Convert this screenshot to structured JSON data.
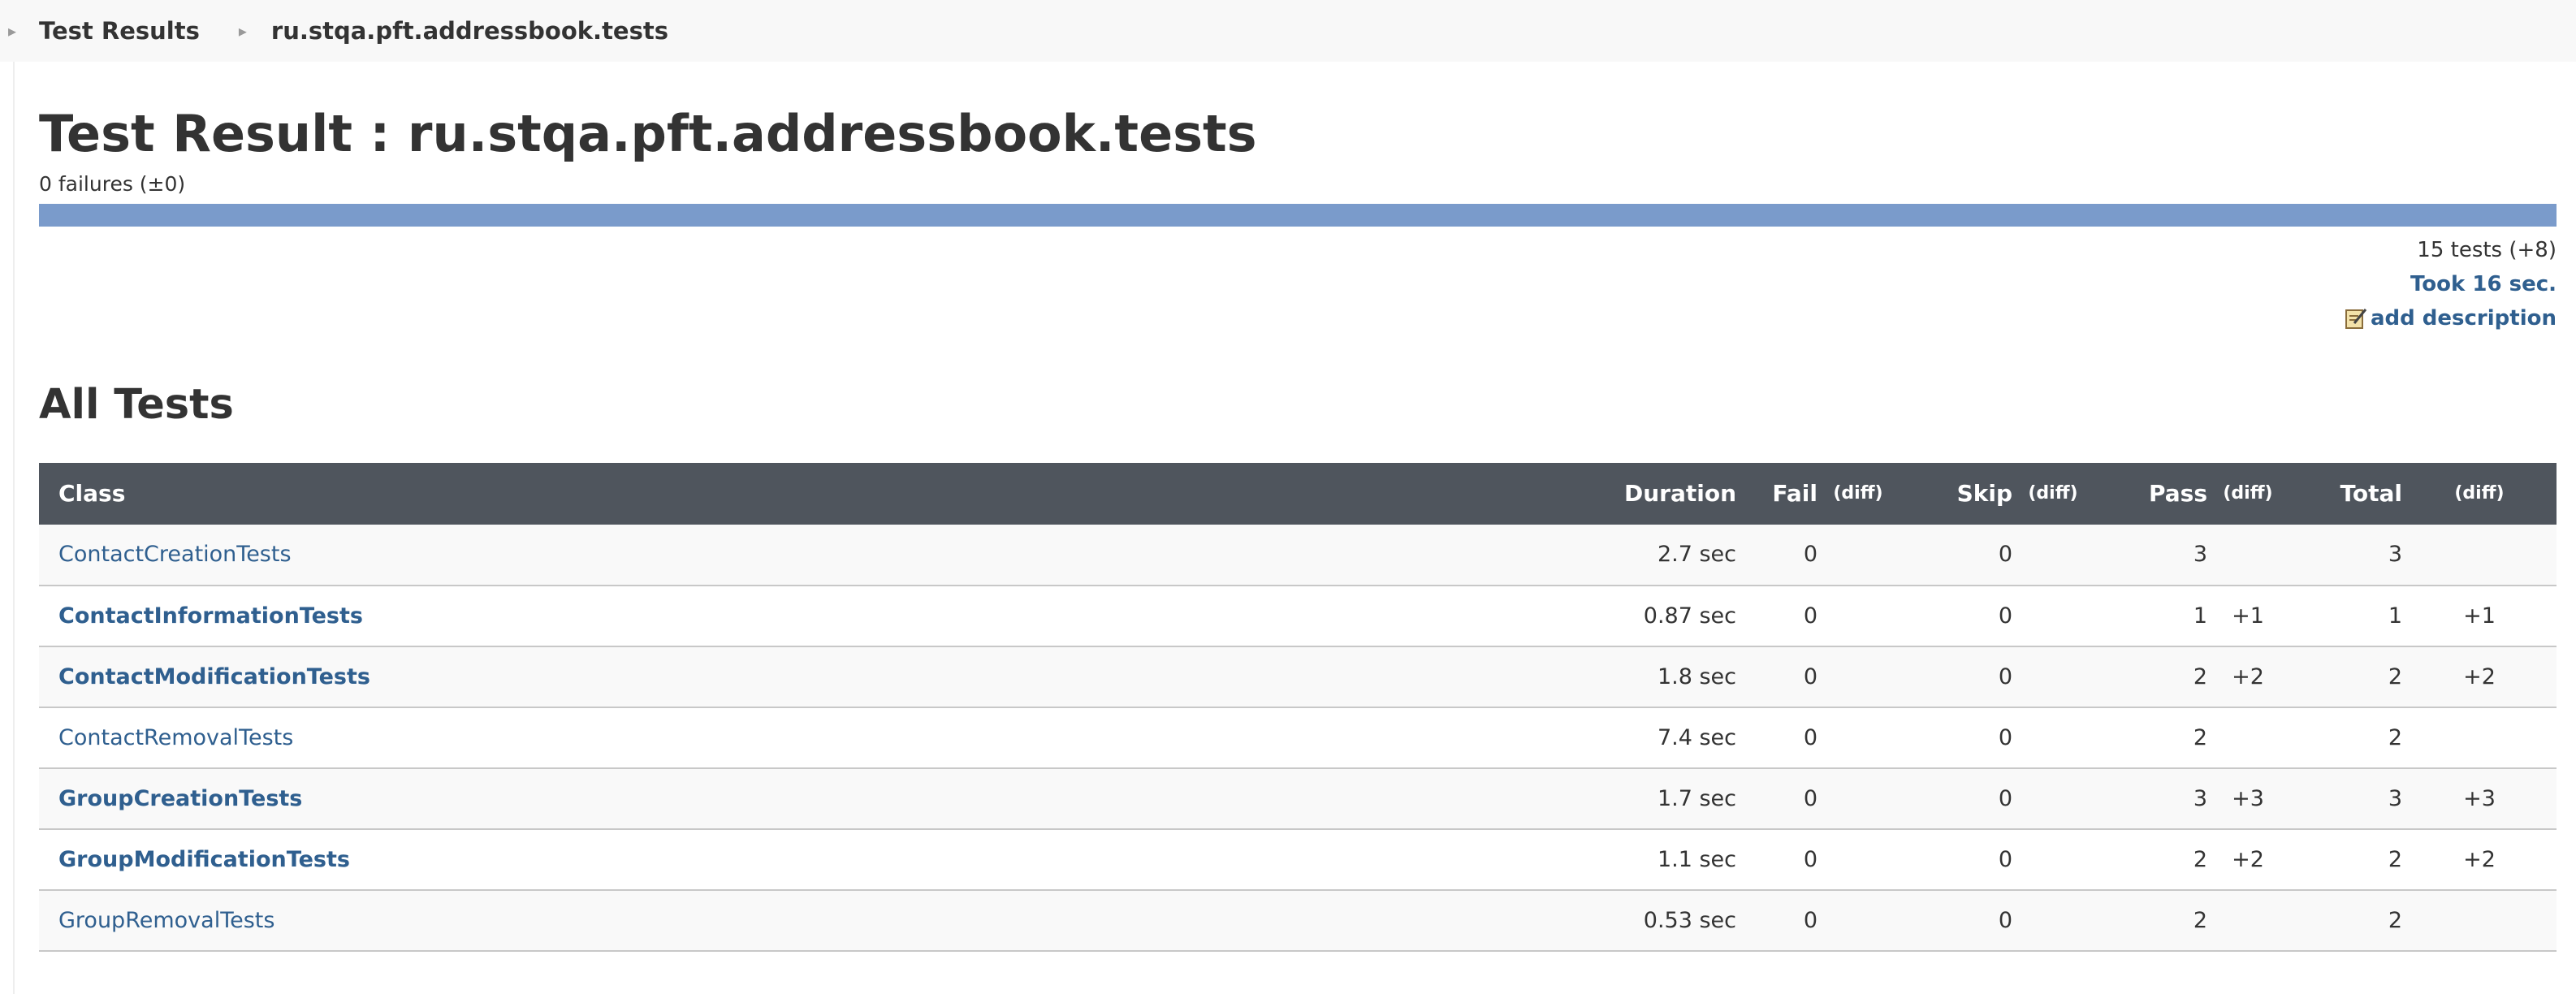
{
  "breadcrumb": {
    "items": [
      "Test Results",
      "ru.stqa.pft.addressbook.tests"
    ]
  },
  "page": {
    "title": "Test Result : ru.stqa.pft.addressbook.tests",
    "failures": "0 failures (±0)"
  },
  "summary": {
    "tests": "15 tests (+8)",
    "took": "Took 16 sec.",
    "add_description": "add description"
  },
  "progress": {
    "pass_fraction": 1.0,
    "color": "#7a9bcb"
  },
  "section": {
    "title": "All Tests"
  },
  "table": {
    "headers": {
      "class": "Class",
      "duration": "Duration",
      "fail": "Fail",
      "fail_diff": "(diff)",
      "skip": "Skip",
      "skip_diff": "(diff)",
      "pass": "Pass",
      "pass_diff": "(diff)",
      "total": "Total",
      "total_diff": "(diff)"
    },
    "rows": [
      {
        "class": "ContactCreationTests",
        "duration": "2.7 sec",
        "fail": "0",
        "fail_diff": "",
        "skip": "0",
        "skip_diff": "",
        "pass": "3",
        "pass_diff": "",
        "total": "3",
        "total_diff": ""
      },
      {
        "class": "ContactInformationTests",
        "duration": "0.87 sec",
        "fail": "0",
        "fail_diff": "",
        "skip": "0",
        "skip_diff": "",
        "pass": "1",
        "pass_diff": "+1",
        "total": "1",
        "total_diff": "+1"
      },
      {
        "class": "ContactModificationTests",
        "duration": "1.8 sec",
        "fail": "0",
        "fail_diff": "",
        "skip": "0",
        "skip_diff": "",
        "pass": "2",
        "pass_diff": "+2",
        "total": "2",
        "total_diff": "+2"
      },
      {
        "class": "ContactRemovalTests",
        "duration": "7.4 sec",
        "fail": "0",
        "fail_diff": "",
        "skip": "0",
        "skip_diff": "",
        "pass": "2",
        "pass_diff": "",
        "total": "2",
        "total_diff": ""
      },
      {
        "class": "GroupCreationTests",
        "duration": "1.7 sec",
        "fail": "0",
        "fail_diff": "",
        "skip": "0",
        "skip_diff": "",
        "pass": "3",
        "pass_diff": "+3",
        "total": "3",
        "total_diff": "+3"
      },
      {
        "class": "GroupModificationTests",
        "duration": "1.1 sec",
        "fail": "0",
        "fail_diff": "",
        "skip": "0",
        "skip_diff": "",
        "pass": "2",
        "pass_diff": "+2",
        "total": "2",
        "total_diff": "+2"
      },
      {
        "class": "GroupRemovalTests",
        "duration": "0.53 sec",
        "fail": "0",
        "fail_diff": "",
        "skip": "0",
        "skip_diff": "",
        "pass": "2",
        "pass_diff": "",
        "total": "2",
        "total_diff": ""
      }
    ]
  },
  "colors": {
    "header_bg": "#4f555d",
    "link": "#2f5f8f",
    "progress": "#7a9bcb"
  },
  "icons": {
    "breadcrumb_separator": "chevron-right-icon",
    "description": "edit-note-icon"
  }
}
